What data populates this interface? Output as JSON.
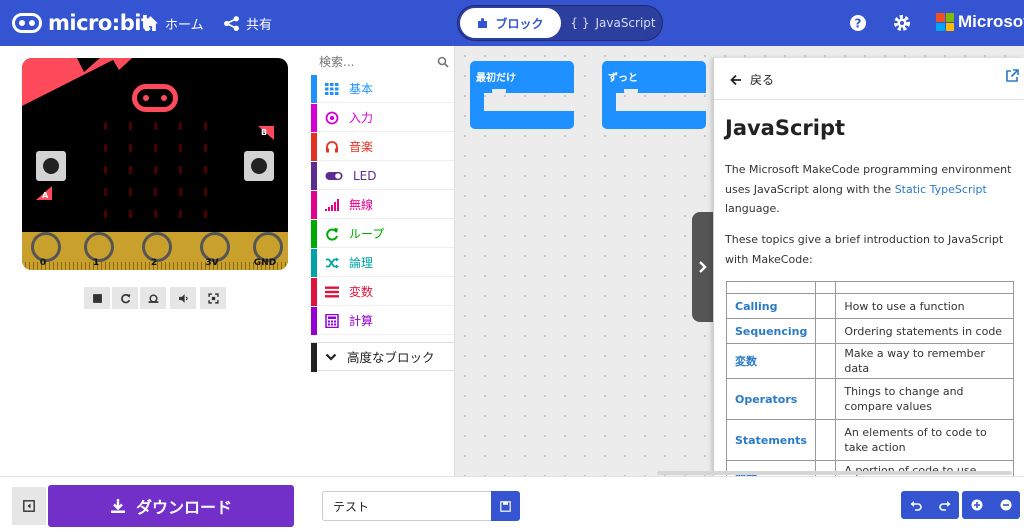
{
  "header": {
    "logo_text": "micro:bit",
    "home_label": "ホーム",
    "share_label": "共有",
    "blocks_label": "ブロック",
    "js_label": "JavaScript",
    "ms_label": "Microsoft",
    "ms_colors": [
      "#f25022",
      "#7fba00",
      "#00a4ef",
      "#ffb900"
    ],
    "brand_color": "#3454d1"
  },
  "simulator": {
    "pins": [
      "0",
      "1",
      "2",
      "3V",
      "GND"
    ],
    "button_a": "A",
    "button_b": "B"
  },
  "toolbox": {
    "search_placeholder": "検索...",
    "categories": [
      {
        "label": "基本",
        "color": "#1e90ff",
        "icon": "grid-icon"
      },
      {
        "label": "入力",
        "color": "#d400d4",
        "icon": "target-icon"
      },
      {
        "label": "音楽",
        "color": "#e63022",
        "icon": "headphones-icon"
      },
      {
        "label": "LED",
        "color": "#5c2d91",
        "icon": "toggle-icon"
      },
      {
        "label": "無線",
        "color": "#e3008c",
        "icon": "signal-icon"
      },
      {
        "label": "ループ",
        "color": "#00aa00",
        "icon": "refresh-icon"
      },
      {
        "label": "論理",
        "color": "#00a4a6",
        "icon": "shuffle-icon"
      },
      {
        "label": "変数",
        "color": "#dc143c",
        "icon": "list-icon"
      },
      {
        "label": "計算",
        "color": "#9400d3",
        "icon": "calculator-icon"
      }
    ],
    "advanced_label": "高度なブロック"
  },
  "workspace": {
    "block_on_start": "最初だけ",
    "block_forever": "ずっと"
  },
  "docs": {
    "back_label": "戻る",
    "title": "JavaScript",
    "intro_pre": "The Microsoft MakeCode programming environment uses JavaScript along with the ",
    "intro_link": "Static TypeScript",
    "intro_post": " language.",
    "topics_text": "These topics give a brief introduction to JavaScript with MakeCode:",
    "rows": [
      {
        "name": "",
        "desc": ""
      },
      {
        "name": "Calling",
        "desc": "How to use a function"
      },
      {
        "name": "Sequencing",
        "desc": "Ordering statements in code"
      },
      {
        "name": "変数",
        "desc": "Make a way to remember data"
      },
      {
        "name": "Operators",
        "desc": "Things to change and compare values"
      },
      {
        "name": "Statements",
        "desc": "An elements of to code to take action"
      },
      {
        "name": "関数",
        "desc": "A portion of code to use again"
      }
    ]
  },
  "bottom": {
    "download_label": "ダウンロード",
    "project_name": "テスト"
  }
}
